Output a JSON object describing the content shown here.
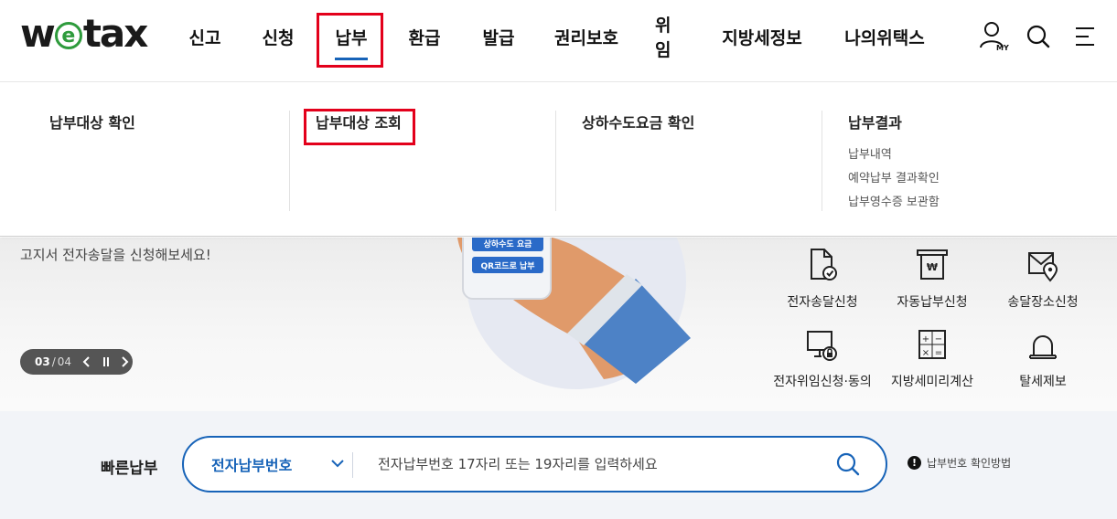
{
  "logo": {
    "pre": "w",
    "mid": "e",
    "post": "tax"
  },
  "gnb": [
    {
      "label": "신고"
    },
    {
      "label": "신청"
    },
    {
      "label": "납부"
    },
    {
      "label": "환급"
    },
    {
      "label": "발급"
    },
    {
      "label": "권리보호"
    },
    {
      "label": "위임"
    },
    {
      "label": "지방세정보"
    },
    {
      "label": "나의위택스"
    }
  ],
  "util": {
    "my_label": "MY"
  },
  "mega": {
    "col1": {
      "title": "납부대상 확인",
      "items": []
    },
    "col2": {
      "title": "납부대상 조회",
      "items": []
    },
    "col3": {
      "title": "상하수도요금 확인",
      "items": []
    },
    "col4": {
      "title": "납부결과",
      "items": [
        "납부내역",
        "예약납부 결과확인",
        "납부영수증 보관함"
      ]
    }
  },
  "hero": {
    "text": "고지서 전자송달을 신청해보세요!",
    "phone_btn1": "상하수도 요금",
    "phone_btn2": "QR코드로 납부",
    "pager": {
      "current": "03",
      "separator": "/",
      "total": "04"
    }
  },
  "quick_links": [
    {
      "label": "전자송달신청",
      "icon": "document-check-icon"
    },
    {
      "label": "자동납부신청",
      "icon": "receipt-won-icon"
    },
    {
      "label": "송달장소신청",
      "icon": "mail-location-icon"
    },
    {
      "label": "전자위임신청·동의",
      "icon": "monitor-lock-icon"
    },
    {
      "label": "지방세미리계산",
      "icon": "calculator-icon"
    },
    {
      "label": "탈세제보",
      "icon": "siren-icon"
    }
  ],
  "quick_pay": {
    "label": "빠른납부",
    "select_value": "전자납부번호",
    "placeholder": "전자납부번호 17자리 또는 19자리를 입력하세요",
    "help_text": "납부번호 확인방법"
  },
  "colors": {
    "brand_blue": "#1763b8",
    "logo_green": "#2e9b3c",
    "highlight_red": "#e3001b"
  }
}
